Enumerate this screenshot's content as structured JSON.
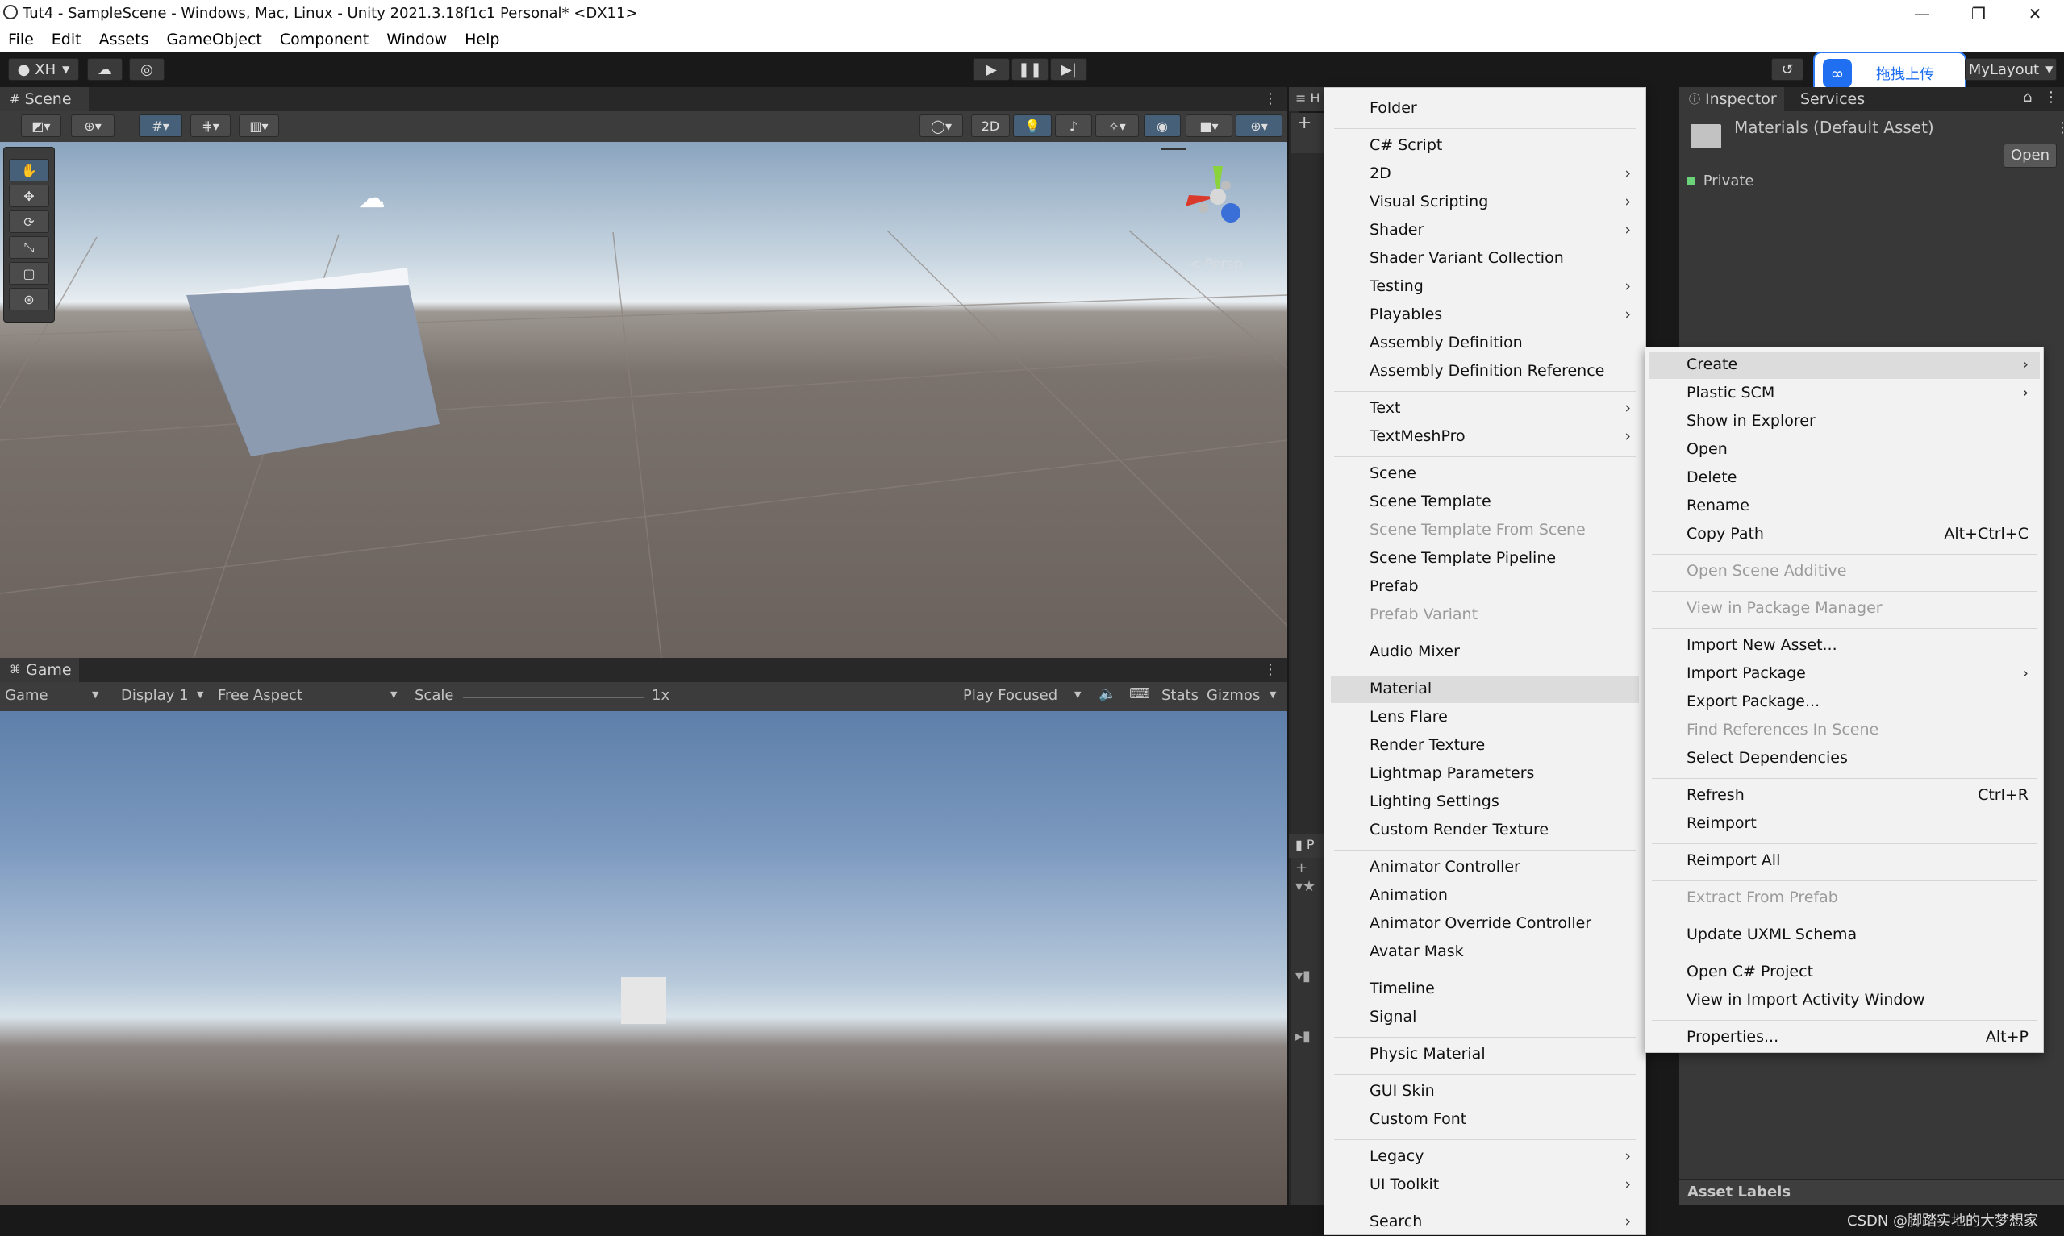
{
  "window": {
    "title": "Tut4 - SampleScene - Windows, Mac, Linux - Unity 2021.3.18f1c1 Personal* <DX11>",
    "minimize": "—",
    "maximize": "❐",
    "close": "✕"
  },
  "menubar": [
    "File",
    "Edit",
    "Assets",
    "GameObject",
    "Component",
    "Window",
    "Help"
  ],
  "toolbar": {
    "account": "XH",
    "layout": "MyLayout",
    "upload_widget": "拖拽上传"
  },
  "scene": {
    "tab": "Scene",
    "toggle_2d": "2D",
    "persp_label": "< Persp"
  },
  "game": {
    "tab": "Game",
    "view_select": "Game",
    "display": "Display 1",
    "aspect": "Free Aspect",
    "scale_label": "Scale",
    "scale_value": "1x",
    "play_focused": "Play Focused",
    "stats": "Stats",
    "gizmos": "Gizmos"
  },
  "create_menu": [
    {
      "label": "Folder"
    },
    {
      "sep": true
    },
    {
      "label": "C# Script"
    },
    {
      "label": "2D",
      "sub": true
    },
    {
      "label": "Visual Scripting",
      "sub": true
    },
    {
      "label": "Shader",
      "sub": true
    },
    {
      "label": "Shader Variant Collection"
    },
    {
      "label": "Testing",
      "sub": true
    },
    {
      "label": "Playables",
      "sub": true
    },
    {
      "label": "Assembly Definition"
    },
    {
      "label": "Assembly Definition Reference"
    },
    {
      "sep": true
    },
    {
      "label": "Text",
      "sub": true
    },
    {
      "label": "TextMeshPro",
      "sub": true
    },
    {
      "sep": true
    },
    {
      "label": "Scene"
    },
    {
      "label": "Scene Template"
    },
    {
      "label": "Scene Template From Scene",
      "disabled": true
    },
    {
      "label": "Scene Template Pipeline"
    },
    {
      "label": "Prefab"
    },
    {
      "label": "Prefab Variant",
      "disabled": true
    },
    {
      "sep": true
    },
    {
      "label": "Audio Mixer"
    },
    {
      "sep": true
    },
    {
      "label": "Material",
      "highlight": true
    },
    {
      "label": "Lens Flare"
    },
    {
      "label": "Render Texture"
    },
    {
      "label": "Lightmap Parameters"
    },
    {
      "label": "Lighting Settings"
    },
    {
      "label": "Custom Render Texture"
    },
    {
      "sep": true
    },
    {
      "label": "Animator Controller"
    },
    {
      "label": "Animation"
    },
    {
      "label": "Animator Override Controller"
    },
    {
      "label": "Avatar Mask"
    },
    {
      "sep": true
    },
    {
      "label": "Timeline"
    },
    {
      "label": "Signal"
    },
    {
      "sep": true
    },
    {
      "label": "Physic Material"
    },
    {
      "sep": true
    },
    {
      "label": "GUI Skin"
    },
    {
      "label": "Custom Font"
    },
    {
      "sep": true
    },
    {
      "label": "Legacy",
      "sub": true
    },
    {
      "label": "UI Toolkit",
      "sub": true
    },
    {
      "sep": true
    },
    {
      "label": "Search",
      "sub": true
    }
  ],
  "context_menu": [
    {
      "label": "Create",
      "sub": true,
      "highlight": true
    },
    {
      "label": "Plastic SCM",
      "sub": true
    },
    {
      "label": "Show in Explorer"
    },
    {
      "label": "Open"
    },
    {
      "label": "Delete"
    },
    {
      "label": "Rename"
    },
    {
      "label": "Copy Path",
      "shortcut": "Alt+Ctrl+C"
    },
    {
      "sep": true
    },
    {
      "label": "Open Scene Additive",
      "disabled": true
    },
    {
      "sep": true
    },
    {
      "label": "View in Package Manager",
      "disabled": true
    },
    {
      "sep": true
    },
    {
      "label": "Import New Asset..."
    },
    {
      "label": "Import Package",
      "sub": true
    },
    {
      "label": "Export Package..."
    },
    {
      "label": "Find References In Scene",
      "disabled": true
    },
    {
      "label": "Select Dependencies"
    },
    {
      "sep": true
    },
    {
      "label": "Refresh",
      "shortcut": "Ctrl+R"
    },
    {
      "label": "Reimport"
    },
    {
      "sep": true
    },
    {
      "label": "Reimport All"
    },
    {
      "sep": true
    },
    {
      "label": "Extract From Prefab",
      "disabled": true
    },
    {
      "sep": true
    },
    {
      "label": "Update UXML Schema"
    },
    {
      "sep": true
    },
    {
      "label": "Open C# Project"
    },
    {
      "label": "View in Import Activity Window"
    },
    {
      "sep": true
    },
    {
      "label": "Properties...",
      "shortcut": "Alt+P"
    }
  ],
  "inspector": {
    "tab": "Inspector",
    "services_tab": "Services",
    "asset_title": "Materials (Default Asset)",
    "open_button": "Open",
    "private_label": "Private",
    "asset_labels": "Asset Labels"
  },
  "hierarchy_tab_partial": "H",
  "project_tab_partial": "P",
  "watermark": "CSDN @脚踏实地的大梦想家"
}
